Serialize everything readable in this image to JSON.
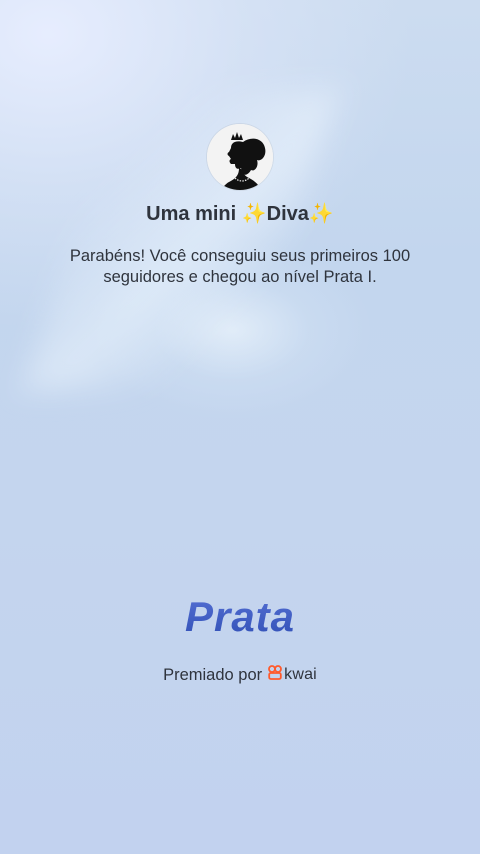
{
  "avatar": {
    "icon": "princess-silhouette-icon"
  },
  "achievement": {
    "title": "Uma mini ✨Diva✨",
    "message_line1": "Parabéns! Você conseguiu seus primeiros 100",
    "message_line2": "seguidores e chegou ao nível Prata I.",
    "level": "Prata"
  },
  "footer": {
    "awarded_by_label": "Premiado por",
    "brand_name": "kwai",
    "brand_icon": "kwai-logo-icon",
    "brand_color": "#ff5a2c"
  },
  "colors": {
    "level_text": "#3d5bc0",
    "body_text": "#2f343d",
    "background": "#c4d5ee"
  }
}
